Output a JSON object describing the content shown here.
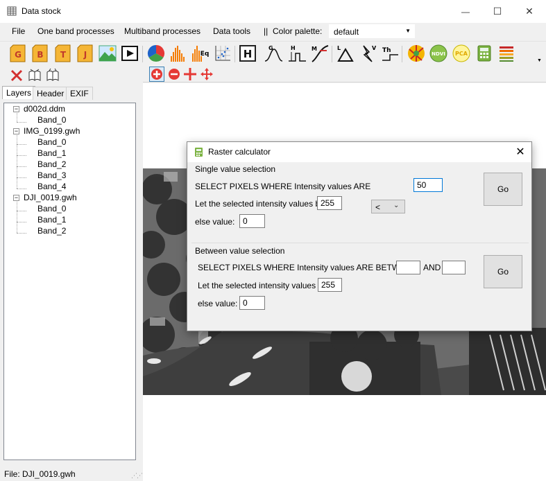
{
  "window": {
    "title": "Data stock",
    "minimize": "—",
    "maximize": "☐",
    "close": "✕"
  },
  "menu": {
    "items": [
      "File",
      "One band processes",
      "Multiband processes",
      "Data tools"
    ],
    "separator": "||",
    "palette_label": "Color palette:",
    "palette_value": "default"
  },
  "toolbar": {
    "buttons": [
      {
        "name": "g-button",
        "letter": "G"
      },
      {
        "name": "b-button",
        "letter": "B"
      },
      {
        "name": "t-button",
        "letter": "T"
      },
      {
        "name": "j-button",
        "letter": "J"
      },
      {
        "name": "landscape-image-button",
        "letter": ""
      },
      {
        "name": "video-button",
        "letter": ""
      },
      {
        "name": "rgb-composite-button",
        "letter": ""
      },
      {
        "name": "histogram-button",
        "letter": ""
      },
      {
        "name": "histogram-equalization-button",
        "letter": "Eq"
      },
      {
        "name": "scatter-plot-button",
        "letter": ""
      },
      {
        "name": "header-button",
        "letter": "H"
      },
      {
        "name": "gaussian-filter-button",
        "letter": "G"
      },
      {
        "name": "high-pass-filter-button",
        "letter": "H"
      },
      {
        "name": "median-filter-button",
        "letter": "M"
      },
      {
        "name": "laplacian-button",
        "letter": "L"
      },
      {
        "name": "vectorize-button",
        "letter": "V"
      },
      {
        "name": "threshold-button",
        "letter": "Th"
      },
      {
        "name": "map-button",
        "letter": ""
      },
      {
        "name": "ndvi-button",
        "letter": "NDVI"
      },
      {
        "name": "pca-button",
        "letter": "PCA"
      },
      {
        "name": "calculator-button",
        "letter": ""
      },
      {
        "name": "color-palette-button",
        "letter": ""
      }
    ]
  },
  "tabs": [
    "Layers",
    "Header",
    "EXIF"
  ],
  "tree": [
    {
      "label": "d002d.ddm",
      "bands": [
        "Band_0"
      ]
    },
    {
      "label": "IMG_0199.gwh",
      "bands": [
        "Band_0",
        "Band_1",
        "Band_2",
        "Band_3",
        "Band_4"
      ]
    },
    {
      "label": "DJI_0019.gwh",
      "bands": [
        "Band_0",
        "Band_1",
        "Band_2"
      ]
    }
  ],
  "status": {
    "text": "File: DJI_0019.gwh"
  },
  "dialog": {
    "title": "Raster calculator",
    "close": "✕",
    "single": {
      "group_label": "Single value selection",
      "select_label": "SELECT PIXELS WHERE Intensity values ARE",
      "operator": "<",
      "value": "50",
      "set_label": "Let the selected intensity values be:",
      "set_value": "255",
      "else_label": "else value:",
      "else_value": "0",
      "go": "Go"
    },
    "between": {
      "group_label": "Between value selection",
      "select_label": "SELECT PIXELS WHERE Intensity values ARE BETWEEN",
      "low_value": "",
      "and_label": "AND",
      "high_value": "",
      "set_label": "Let the selected intensity values be:",
      "set_value": "255",
      "else_label": "else value:",
      "else_value": "0",
      "go": "Go"
    }
  }
}
